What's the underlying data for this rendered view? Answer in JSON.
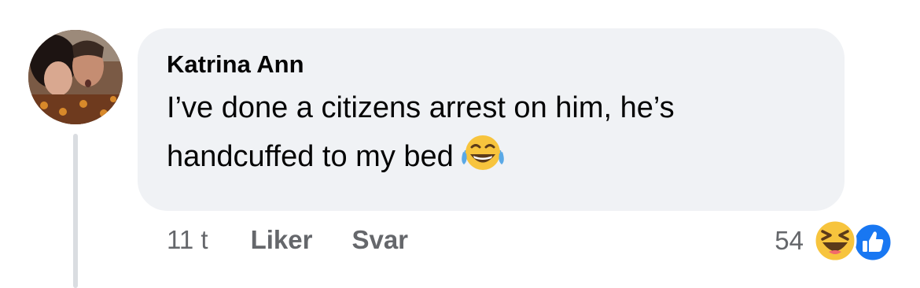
{
  "comment": {
    "author": "Katrina Ann",
    "text": "I’ve done a citizens arrest on him, he’s handcuffed to my bed",
    "inline_emoji": "face-with-tears-of-joy-icon"
  },
  "actions": {
    "timestamp": "11 t",
    "like_label": "Liker",
    "reply_label": "Svar"
  },
  "reactions": {
    "count": "54",
    "icons": [
      "haha-reaction-icon",
      "like-reaction-icon"
    ]
  },
  "colors": {
    "bubble": "#f0f2f5",
    "secondary_text": "#65676b",
    "thread_line": "#dadde1",
    "like_blue": "#1877f2",
    "haha_yellow": "#f7c43d"
  }
}
